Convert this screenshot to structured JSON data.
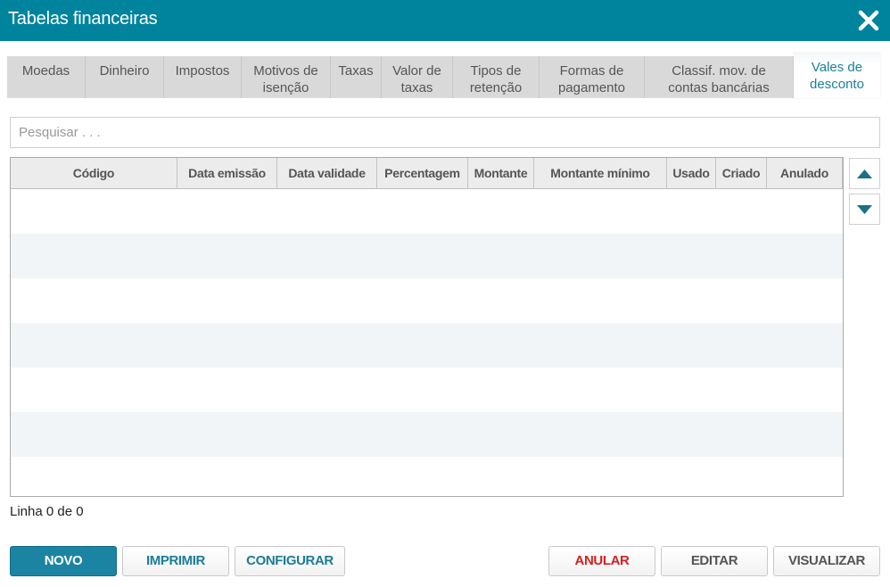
{
  "window": {
    "title": "Tabelas financeiras"
  },
  "tabs": [
    {
      "label": "Moedas"
    },
    {
      "label": "Dinheiro"
    },
    {
      "label": "Impostos"
    },
    {
      "label": "Motivos de\nisenção"
    },
    {
      "label": "Taxas"
    },
    {
      "label": "Valor de\ntaxas"
    },
    {
      "label": "Tipos de\nretenção"
    },
    {
      "label": "Formas de\npagamento"
    },
    {
      "label": "Classif. mov. de\ncontas bancárias"
    },
    {
      "label": "Vales de\ndesconto",
      "active": true
    }
  ],
  "search": {
    "placeholder": "Pesquisar . . ."
  },
  "table": {
    "columns": [
      "Código",
      "Data emissão",
      "Data validade",
      "Percentagem",
      "Montante",
      "Montante mínimo",
      "Usado",
      "Criado",
      "Anulado"
    ],
    "rows": []
  },
  "status": {
    "text": "Linha 0 de 0"
  },
  "buttons": {
    "novo": "NOVO",
    "imprimir": "IMPRIMIR",
    "configurar": "CONFIGURAR",
    "anular": "ANULAR",
    "editar": "EDITAR",
    "visualizar": "VISUALIZAR"
  },
  "colors": {
    "titlebar": "#00849e",
    "accent": "#1b84a2",
    "danger": "#d62020",
    "row_alt": "#f1f5f8"
  },
  "icons": {
    "close": "close-icon",
    "scroll_up": "triangle-up-icon",
    "scroll_down": "triangle-down-icon"
  }
}
